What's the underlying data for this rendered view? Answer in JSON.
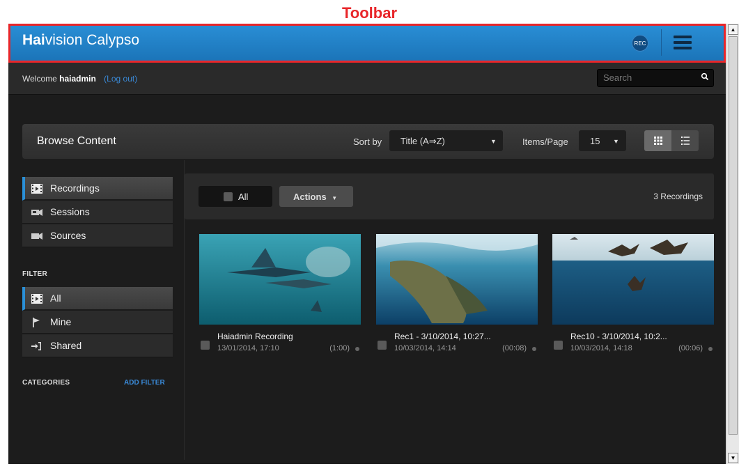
{
  "annotation": "Toolbar",
  "header": {
    "brand_bold": "Hai",
    "brand_rest": "vision Calypso",
    "rec_label": "REC"
  },
  "subbar": {
    "welcome": "Welcome",
    "username": "haiadmin",
    "logout": "(Log out)",
    "search_placeholder": "Search"
  },
  "browse": {
    "title": "Browse Content",
    "sort_label": "Sort by",
    "sort_value": "Title (A⇒Z)",
    "items_label": "Items/Page",
    "items_value": "15"
  },
  "sidebar": {
    "content_types": [
      {
        "label": "Recordings",
        "icon": "film-icon",
        "active": true
      },
      {
        "label": "Sessions",
        "icon": "session-camera-icon",
        "active": false
      },
      {
        "label": "Sources",
        "icon": "video-camera-icon",
        "active": false
      }
    ],
    "filter_label": "FILTER",
    "filters": [
      {
        "label": "All",
        "icon": "film-icon",
        "active": true
      },
      {
        "label": "Mine",
        "icon": "flag-icon",
        "active": false
      },
      {
        "label": "Shared",
        "icon": "share-icon",
        "active": false
      }
    ],
    "categories_label": "CATEGORIES",
    "add_filter": "ADD FILTER"
  },
  "toolbar": {
    "all_label": "All",
    "actions_label": "Actions",
    "count": "3 Recordings"
  },
  "recordings": [
    {
      "title": "Haiadmin Recording",
      "date": "13/01/2014, 17:10",
      "duration": "(1:00)"
    },
    {
      "title": "Rec1 - 3/10/2014, 10:27...",
      "date": "10/03/2014, 14:14",
      "duration": "(00:08)"
    },
    {
      "title": "Rec10 - 3/10/2014, 10:2...",
      "date": "10/03/2014, 14:18",
      "duration": "(00:06)"
    }
  ],
  "colors": {
    "accent": "#2a8fd6",
    "annotation": "#e8262a",
    "background": "#1c1c1c"
  }
}
